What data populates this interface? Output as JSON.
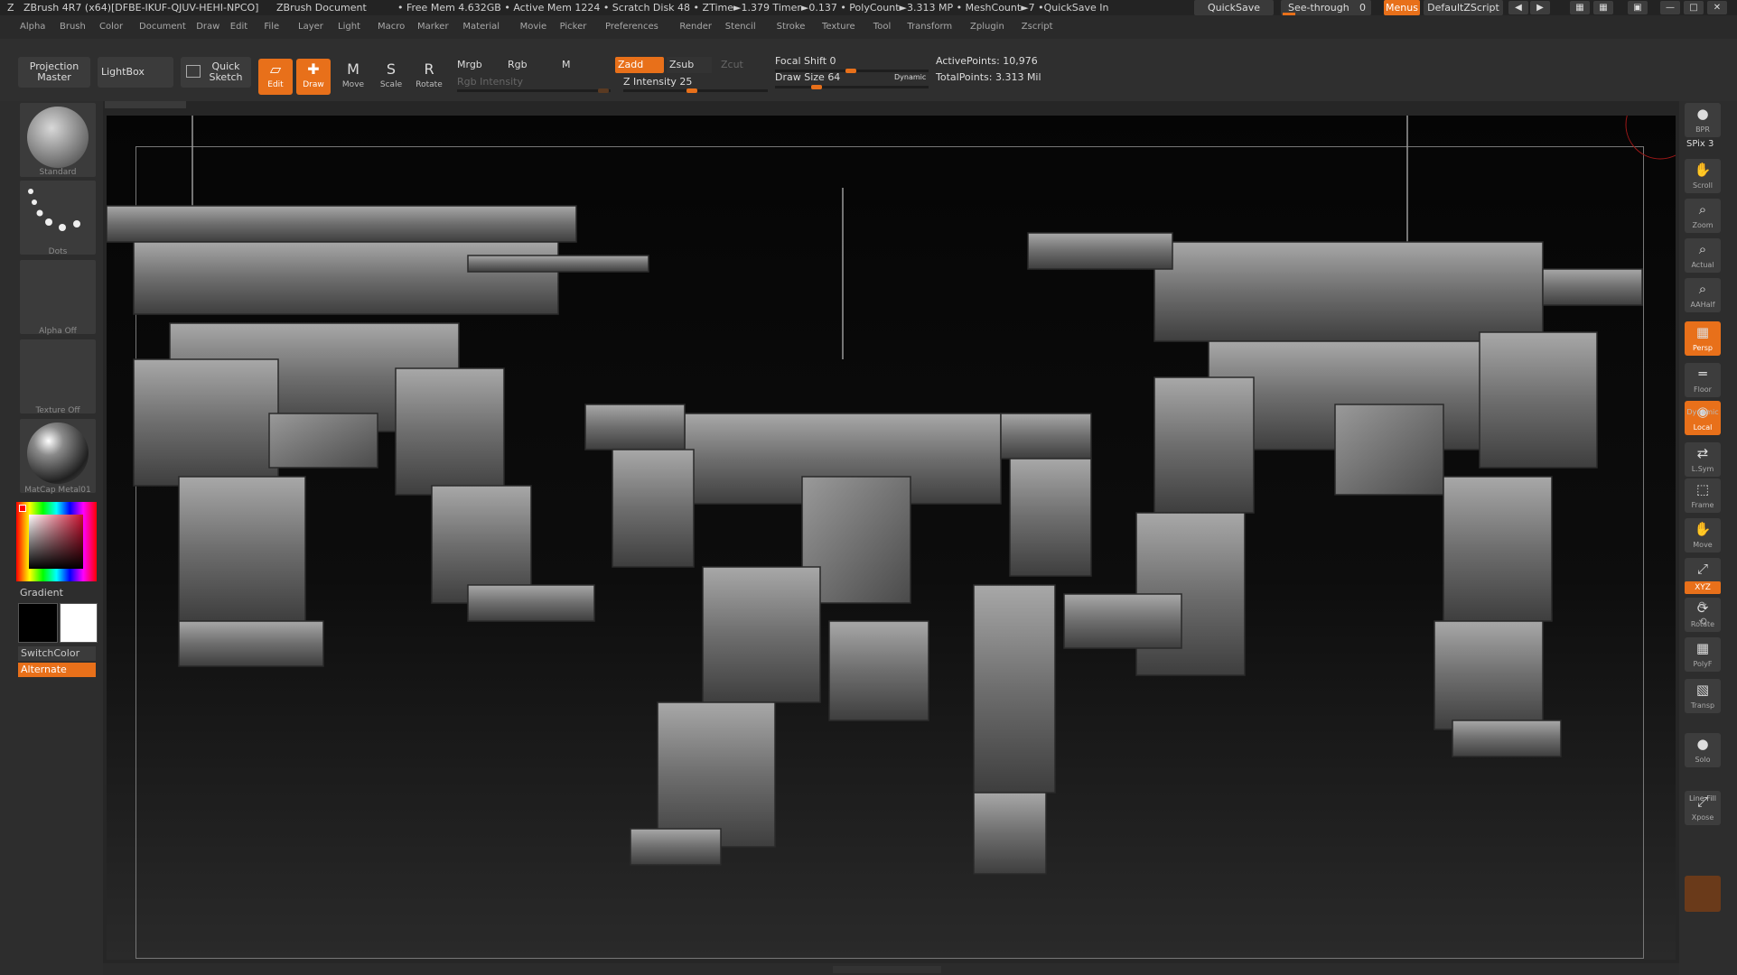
{
  "title_bar": {
    "app": "ZBrush 4R7 (x64)[DFBE-IKUF-QJUV-HEHI-NPCO]",
    "document": "ZBrush Document",
    "stats": "• Free Mem 4.632GB • Active Mem 1224 • Scratch Disk 48 • ZTime►1.379 Timer►0.137 • PolyCount►3.313 MP • MeshCount►7 •QuickSave In",
    "quicksave": "QuickSave",
    "see_through": "See-through",
    "see_through_value": "0",
    "menus": "Menus",
    "default_zscript": "DefaultZScript"
  },
  "menu_bar": [
    "Alpha",
    "Brush",
    "Color",
    "Document",
    "Draw",
    "Edit",
    "File",
    "Layer",
    "Light",
    "Macro",
    "Marker",
    "Material",
    "Movie",
    "Picker",
    "Preferences",
    "Render",
    "Stencil",
    "Stroke",
    "Texture",
    "Tool",
    "Transform",
    "Zplugin",
    "Zscript"
  ],
  "toolbar": {
    "projection_master": [
      "Projection",
      "Master"
    ],
    "lightbox": "LightBox",
    "quick_sketch": [
      "Quick",
      "Sketch"
    ],
    "tools": [
      {
        "label": "Edit",
        "icon": "edit-icon",
        "glyph": "▱",
        "active": true
      },
      {
        "label": "Draw",
        "icon": "draw-icon",
        "glyph": "✚",
        "active": true
      },
      {
        "label": "Move",
        "icon": "move-icon",
        "glyph": "M",
        "active": false
      },
      {
        "label": "Scale",
        "icon": "scale-icon",
        "glyph": "S",
        "active": false
      },
      {
        "label": "Rotate",
        "icon": "rotate-icon",
        "glyph": "R",
        "active": false
      }
    ],
    "mrgb": "Mrgb",
    "rgb": "Rgb",
    "m": "M",
    "rgb_intensity": "Rgb Intensity",
    "zadd": "Zadd",
    "zsub": "Zsub",
    "zcut": "Zcut",
    "z_intensity_label": "Z Intensity",
    "z_intensity_value": "25",
    "focal_shift_label": "Focal Shift",
    "focal_shift_value": "0",
    "draw_size_label": "Draw Size",
    "draw_size_value": "64",
    "dynamic": "Dynamic",
    "active_points_label": "ActivePoints:",
    "active_points_value": "10,976",
    "total_points_label": "TotalPoints:",
    "total_points_value": "3.313 Mil"
  },
  "left_shelf": {
    "brush": "Standard",
    "stroke": "Dots",
    "alpha": "Alpha Off",
    "texture": "Texture Off",
    "material": "MatCap Metal01",
    "gradient": "Gradient",
    "switch_color": "SwitchColor",
    "alternate": "Alternate"
  },
  "right_shelf": [
    {
      "label": "BPR",
      "icon": "bpr-icon",
      "glyph": "●",
      "active": false
    },
    {
      "label": "Scroll",
      "icon": "scroll-icon",
      "glyph": "✋",
      "active": false
    },
    {
      "label": "Zoom",
      "icon": "zoom-icon",
      "glyph": "⌕",
      "active": false
    },
    {
      "label": "Actual",
      "icon": "actual-icon",
      "glyph": "⌕",
      "active": false
    },
    {
      "label": "AAHalf",
      "icon": "aahalf-icon",
      "glyph": "⌕",
      "active": false
    },
    {
      "label": "Persp",
      "icon": "persp-icon",
      "glyph": "▦",
      "active": true
    },
    {
      "label": "Floor",
      "icon": "floor-icon",
      "glyph": "═",
      "active": false
    },
    {
      "label": "Local",
      "icon": "local-icon",
      "glyph": "◉",
      "active": true
    },
    {
      "label": "L.Sym",
      "icon": "lsym-icon",
      "glyph": "⇄",
      "active": false
    },
    {
      "label": "Frame",
      "icon": "frame-icon",
      "glyph": "⬚",
      "active": false
    },
    {
      "label": "Move",
      "icon": "move-view-icon",
      "glyph": "✋",
      "active": false
    },
    {
      "label": "Scale",
      "icon": "scale-view-icon",
      "glyph": "⤢",
      "active": false
    },
    {
      "label": "Rotate",
      "icon": "rotate-view-icon",
      "glyph": "⟳",
      "active": false
    },
    {
      "label": "PolyF",
      "icon": "polyf-icon",
      "glyph": "▦",
      "active": false
    },
    {
      "label": "Transp",
      "icon": "transp-icon",
      "glyph": "▧",
      "active": false
    },
    {
      "label": "Solo",
      "icon": "solo-icon",
      "glyph": "●",
      "active": false
    },
    {
      "label": "Xpose",
      "icon": "xpose-icon",
      "glyph": "⤢",
      "active": false
    }
  ],
  "right_extra": {
    "spix_label": "SPix",
    "spix_value": "3",
    "xyz": "XYZ",
    "dynamic": "Dynamic",
    "line_fill": "Line Fill"
  },
  "colors": {
    "accent": "#e8701a",
    "ui_bg": "#2d2d2d"
  }
}
